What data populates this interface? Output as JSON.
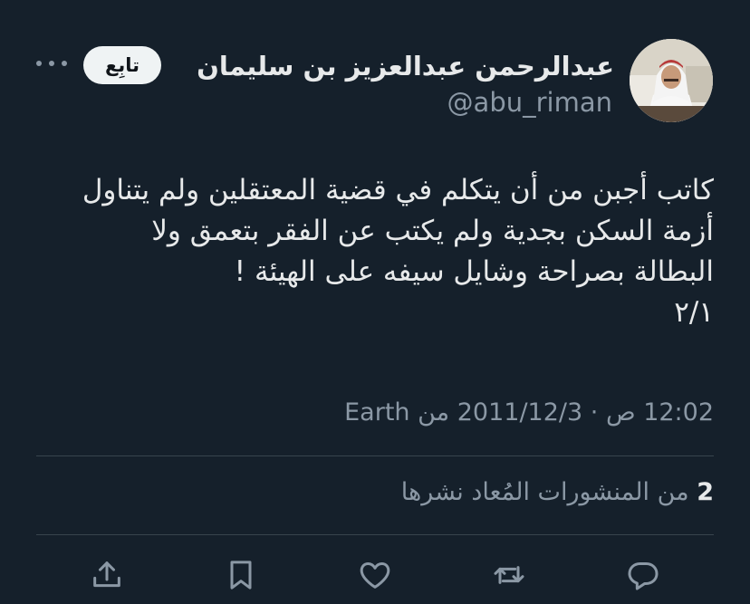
{
  "author": {
    "name": "عبدالرحمن عبدالعزيز بن سليمان",
    "handle": "@abu_riman"
  },
  "follow_label": "تابِع",
  "tweet": {
    "lines": [
      "كاتب أجبن من أن يتكلم في قضية المعتقلين ولم يتناول",
      "أزمة السكن بجدية ولم يكتب عن الفقر بتعمق ولا",
      "البطالة بصراحة وشايل سيفه على الهيئة !",
      "٢/١"
    ]
  },
  "meta": {
    "time": "12:02 ص",
    "date": "2011/12/3",
    "source": "من Earth",
    "separator": "·"
  },
  "stats": {
    "reposts_count": "2",
    "reposts_label": "من المنشورات المُعاد نشرها"
  },
  "icons": {
    "more": "more-horizontal-icon",
    "reply": "reply-icon",
    "repost": "repost-icon",
    "like": "heart-icon",
    "bookmark": "bookmark-icon",
    "share": "share-icon"
  },
  "colors": {
    "background": "#15202b",
    "text": "#e7e9ea",
    "secondary": "#8b98a5",
    "divider": "#38444d",
    "button_bg": "#eff3f4"
  }
}
